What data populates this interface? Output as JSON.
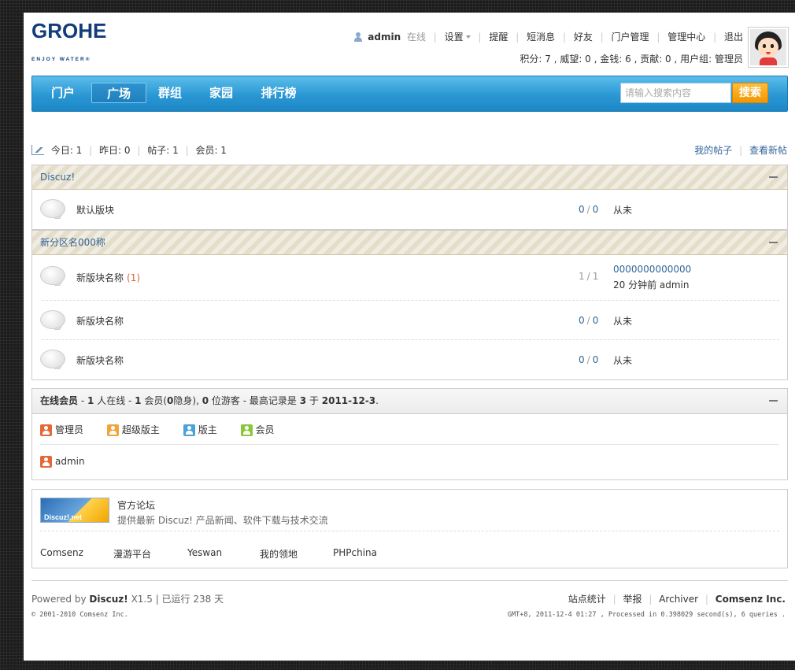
{
  "header": {
    "logo_brand": "GROHE",
    "logo_tagline": "ENJOY WATER®",
    "username": "admin",
    "online_status": "在线",
    "settings": "设置",
    "links": [
      "提醒",
      "短消息",
      "好友",
      "门户管理",
      "管理中心",
      "退出"
    ],
    "credits": "积分: 7 , 威望: 0 , 金钱: 6 , 贡献: 0 , 用户组: 管理员"
  },
  "nav": {
    "items": [
      "门户",
      "广场",
      "群组",
      "家园",
      "排行榜"
    ],
    "active": "广场",
    "search_placeholder": "请输入搜索内容",
    "search_button": "搜索"
  },
  "stats": {
    "today": "今日: 1",
    "yesterday": "昨日: 0",
    "posts": "帖子: 1",
    "members": "会员: 1",
    "my_posts": "我的帖子",
    "new_posts": "查看新帖"
  },
  "categories": [
    {
      "title": "Discuz!",
      "forums": [
        {
          "name": "默认版块",
          "new_count": "",
          "threads": "0",
          "posts": "0",
          "last": "从未",
          "last_meta": ""
        }
      ]
    },
    {
      "title": "新分区名000称",
      "forums": [
        {
          "name": "新版块名称",
          "new_count": "(1)",
          "threads": "1",
          "posts": "1",
          "last": "0000000000000",
          "last_meta": "20 分钟前  admin"
        },
        {
          "name": "新版块名称",
          "new_count": "",
          "threads": "0",
          "posts": "0",
          "last": "从未",
          "last_meta": ""
        },
        {
          "name": "新版块名称",
          "new_count": "",
          "threads": "0",
          "posts": "0",
          "last": "从未",
          "last_meta": ""
        }
      ]
    }
  ],
  "online": {
    "title": "在线会员",
    "summary_total": "1",
    "summary_members": "1",
    "summary_hidden": "0",
    "summary_guests": "0",
    "record": "3",
    "record_date": "2011-12-3",
    "t1": "人在线  -",
    "t2": "会员(",
    "t3": "隐身),",
    "t4": "位游客  - 最高记录是",
    "t5": "于",
    "roles": [
      {
        "label": "管理员",
        "color": "#e2683a"
      },
      {
        "label": "超级版主",
        "color": "#f0a53a"
      },
      {
        "label": "版主",
        "color": "#4aa3d8"
      },
      {
        "label": "会员",
        "color": "#8cc63e"
      }
    ],
    "users": [
      "admin"
    ]
  },
  "links_section": {
    "logo_text": "Discuz!.net",
    "official_title": "官方论坛",
    "official_desc": "提供最新 Discuz! 产品新闻、软件下载与技术交流",
    "friends": [
      "Comsenz",
      "漫游平台",
      "Yeswan",
      "我的领地",
      "PHPchina"
    ]
  },
  "footer": {
    "powered_prefix": "Powered by",
    "product": "Discuz!",
    "version": "X1.5",
    "running": "| 已运行 238 天",
    "copyright": "© 2001-2010 Comsenz Inc.",
    "links": [
      "站点统计",
      "举报",
      "Archiver"
    ],
    "company": "Comsenz Inc.",
    "processed": "GMT+8, 2011-12-4 01:27 , Processed in 0.398029 second(s), 6 queries ."
  }
}
